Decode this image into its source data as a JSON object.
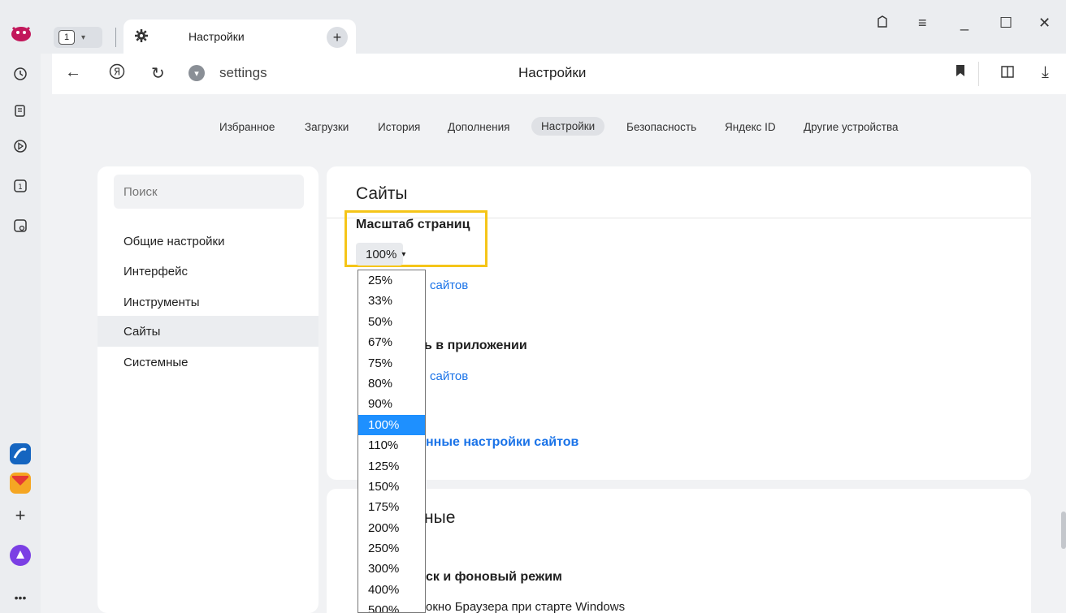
{
  "tab": {
    "count": "1",
    "title": "Настройки"
  },
  "address": {
    "url": "settings",
    "page_title": "Настройки"
  },
  "topnav": [
    "Избранное",
    "Загрузки",
    "История",
    "Дополнения",
    "Настройки",
    "Безопасность",
    "Яндекс ID",
    "Другие устройства"
  ],
  "search": {
    "placeholder": "Поиск"
  },
  "left_menu": [
    "Общие настройки",
    "Интерфейс",
    "Инструменты",
    "Сайты",
    "Системные"
  ],
  "card1": {
    "title": "Сайты",
    "zoom_label": "Масштаб страниц",
    "zoom_value": "100%",
    "link1": "сайтов",
    "open_in_app": "ь в приложении",
    "link2": "сайтов",
    "advanced_link": "нные настройки сайтов"
  },
  "card2": {
    "title": "ные",
    "section": "ск и фоновый режим",
    "option": "окно Браузера при старте Windows"
  },
  "dropdown": {
    "options": [
      "25%",
      "33%",
      "50%",
      "67%",
      "75%",
      "80%",
      "90%",
      "100%",
      "110%",
      "125%",
      "150%",
      "175%",
      "200%",
      "250%",
      "300%",
      "400%",
      "500%"
    ],
    "selected": "100%"
  }
}
